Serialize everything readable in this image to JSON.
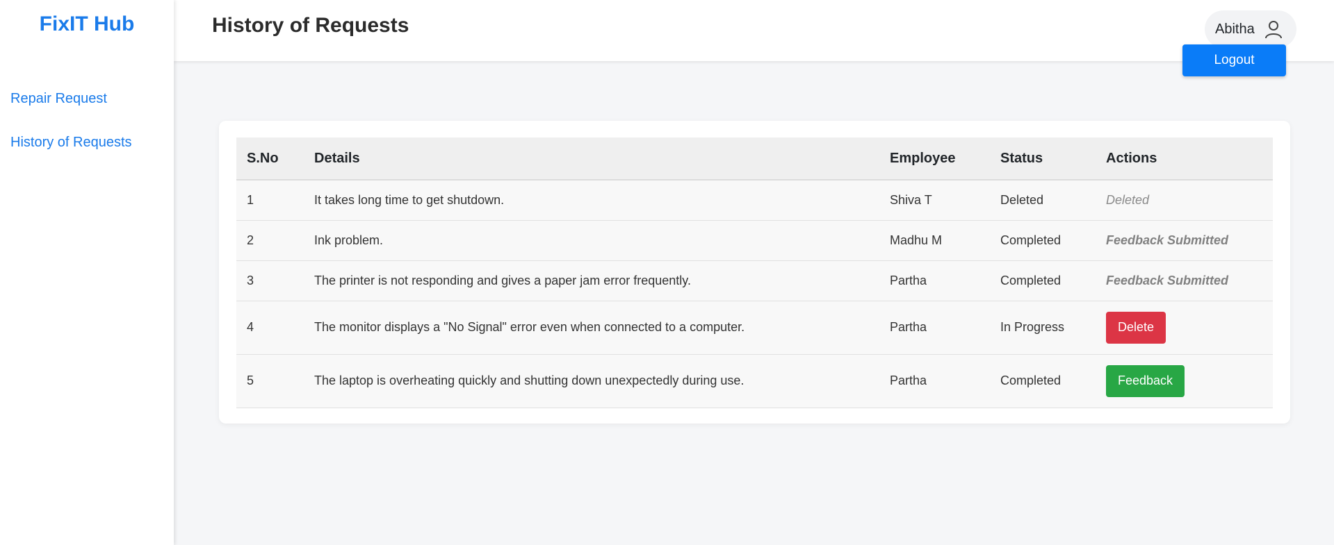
{
  "brand": "FixIT Hub",
  "sidebar": {
    "items": [
      {
        "label": "Repair Request"
      },
      {
        "label": "History of Requests"
      }
    ]
  },
  "header": {
    "title": "History of Requests",
    "user": {
      "name": "Abitha",
      "icon": "user-icon"
    },
    "logout_label": "Logout"
  },
  "table": {
    "columns": [
      "S.No",
      "Details",
      "Employee",
      "Status",
      "Actions"
    ],
    "rows": [
      {
        "sno": "1",
        "details": "It takes long time to get shutdown.",
        "employee": "Shiva T",
        "status": "Deleted",
        "action": "Deleted",
        "action_type": "text-muted"
      },
      {
        "sno": "2",
        "details": "Ink problem.",
        "employee": "Madhu M",
        "status": "Completed",
        "action": "Feedback Submitted",
        "action_type": "text-bold"
      },
      {
        "sno": "3",
        "details": "The printer is not responding and gives a paper jam error frequently.",
        "employee": "Partha",
        "status": "Completed",
        "action": "Feedback Submitted",
        "action_type": "text-bold"
      },
      {
        "sno": "4",
        "details": "The monitor displays a \"No Signal\" error even when connected to a computer.",
        "employee": "Partha",
        "status": "In Progress",
        "action": "Delete",
        "action_type": "button-danger"
      },
      {
        "sno": "5",
        "details": "The laptop is overheating quickly and shutting down unexpectedly during use.",
        "employee": "Partha",
        "status": "Completed",
        "action": "Feedback",
        "action_type": "button-success"
      }
    ]
  },
  "colors": {
    "brand": "#1a7bea",
    "primary": "#0a7cf8",
    "danger": "#dc3545",
    "success": "#28a745"
  }
}
